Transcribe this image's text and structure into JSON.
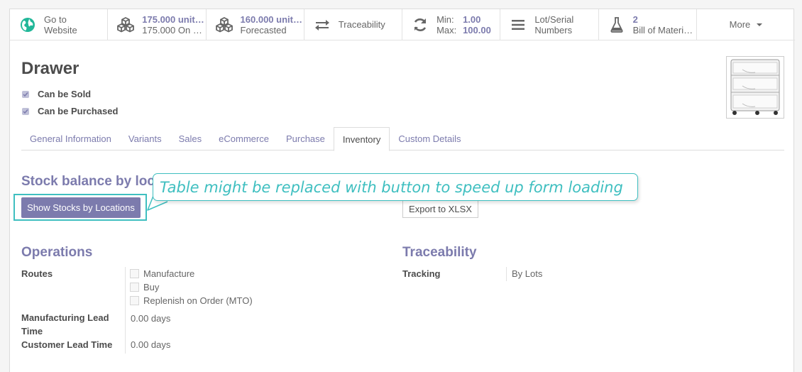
{
  "smart_buttons": [
    {
      "icon": "globe-icon",
      "line1": "Go to",
      "line2": "Website"
    },
    {
      "icon": "cubes-icon",
      "line1": "175.000 unit…",
      "line2": "175.000 On …"
    },
    {
      "icon": "cubes-icon",
      "line1": "160.000 unit…",
      "line2": "Forecasted"
    },
    {
      "icon": "exchange-icon",
      "line1": "Traceability"
    },
    {
      "icon": "refresh-icon",
      "min_label": "Min:",
      "min_value": "1.00",
      "max_label": "Max:",
      "max_value": "100.00"
    },
    {
      "icon": "list-icon",
      "line1": "Lot/Serial",
      "line2": "Numbers"
    },
    {
      "icon": "flask-icon",
      "line1": "2",
      "line2": "Bill of Materi…"
    },
    {
      "icon": "caret-down-icon",
      "line1": "More"
    }
  ],
  "product": {
    "name": "Drawer",
    "can_be_sold_label": "Can be Sold",
    "can_be_purchased_label": "Can be Purchased",
    "can_be_sold": true,
    "can_be_purchased": true
  },
  "tabs": [
    "General Information",
    "Variants",
    "Sales",
    "eCommerce",
    "Purchase",
    "Inventory",
    "Custom Details"
  ],
  "active_tab": "Inventory",
  "stock": {
    "title": "Stock balance by locations",
    "show_button": "Show Stocks by Locations",
    "export_button": "Export to XLSX"
  },
  "callout": {
    "text": "Table might be replaced with button to speed up form loading"
  },
  "operations": {
    "title": "Operations",
    "routes_label": "Routes",
    "routes": [
      "Manufacture",
      "Buy",
      "Replenish on Order (MTO)"
    ],
    "mfg_lead_label_1": "Manufacturing Lead",
    "mfg_lead_label_2": "Time",
    "mfg_lead_value": "0.00 days",
    "customer_lead_label": "Customer Lead Time",
    "customer_lead_value": "0.00 days"
  },
  "traceability": {
    "title": "Traceability",
    "tracking_label": "Tracking",
    "tracking_value": "By Lots"
  },
  "colors": {
    "accent": "#7c7bad",
    "callout": "#3fbfc0",
    "globe": "#21b799"
  }
}
